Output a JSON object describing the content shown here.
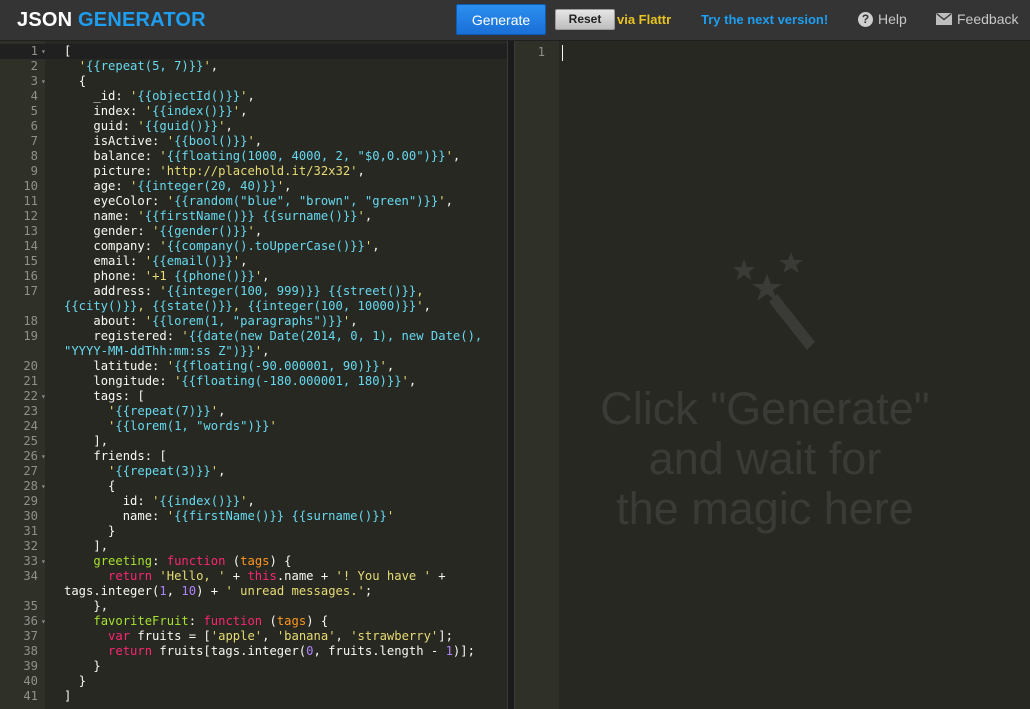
{
  "header": {
    "logo_part1": "JSON ",
    "logo_part2": "GENERATOR",
    "generate_label": "Generate",
    "reset_label": "Reset",
    "flattr_label": "via Flattr",
    "next_version_label": "Try the next version!",
    "help_label": "Help",
    "help_icon": "?",
    "feedback_label": "Feedback"
  },
  "output": {
    "line_number": "1",
    "placeholder_lines": [
      "Click \"Generate\"",
      "and wait for",
      "the magic here"
    ]
  },
  "editor": {
    "line_numbers": [
      "1",
      "2",
      "3",
      "4",
      "5",
      "6",
      "7",
      "8",
      "9",
      "10",
      "11",
      "12",
      "13",
      "14",
      "15",
      "16",
      "17",
      "18",
      "19",
      "20",
      "21",
      "22",
      "23",
      "24",
      "25",
      "26",
      "27",
      "28",
      "29",
      "30",
      "31",
      "32",
      "33",
      "34",
      "35",
      "36",
      "37",
      "38",
      "39",
      "40",
      "41"
    ],
    "lines": [
      [
        {
          "t": "["
        }
      ],
      [
        {
          "t": "  "
        },
        {
          "c": "s",
          "t": "'"
        },
        {
          "c": "t",
          "t": "{{repeat(5, 7)}}"
        },
        {
          "c": "s",
          "t": "'"
        },
        {
          "t": ","
        }
      ],
      [
        {
          "t": "  {"
        }
      ],
      [
        {
          "t": "    _id: "
        },
        {
          "c": "s",
          "t": "'"
        },
        {
          "c": "t",
          "t": "{{objectId()}}"
        },
        {
          "c": "s",
          "t": "'"
        },
        {
          "t": ","
        }
      ],
      [
        {
          "t": "    index: "
        },
        {
          "c": "s",
          "t": "'"
        },
        {
          "c": "t",
          "t": "{{index()}}"
        },
        {
          "c": "s",
          "t": "'"
        },
        {
          "t": ","
        }
      ],
      [
        {
          "t": "    guid: "
        },
        {
          "c": "s",
          "t": "'"
        },
        {
          "c": "t",
          "t": "{{guid()}}"
        },
        {
          "c": "s",
          "t": "'"
        },
        {
          "t": ","
        }
      ],
      [
        {
          "t": "    isActive: "
        },
        {
          "c": "s",
          "t": "'"
        },
        {
          "c": "t",
          "t": "{{bool()}}"
        },
        {
          "c": "s",
          "t": "'"
        },
        {
          "t": ","
        }
      ],
      [
        {
          "t": "    balance: "
        },
        {
          "c": "s",
          "t": "'"
        },
        {
          "c": "t",
          "t": "{{floating(1000, 4000, 2, \"$0,0.00\")}}"
        },
        {
          "c": "s",
          "t": "'"
        },
        {
          "t": ","
        }
      ],
      [
        {
          "t": "    picture: "
        },
        {
          "c": "s",
          "t": "'http://placehold.it/32x32'"
        },
        {
          "t": ","
        }
      ],
      [
        {
          "t": "    age: "
        },
        {
          "c": "s",
          "t": "'"
        },
        {
          "c": "t",
          "t": "{{integer(20, 40)}}"
        },
        {
          "c": "s",
          "t": "'"
        },
        {
          "t": ","
        }
      ],
      [
        {
          "t": "    eyeColor: "
        },
        {
          "c": "s",
          "t": "'"
        },
        {
          "c": "t",
          "t": "{{random(\"blue\", \"brown\", \"green\")}}"
        },
        {
          "c": "s",
          "t": "'"
        },
        {
          "t": ","
        }
      ],
      [
        {
          "t": "    name: "
        },
        {
          "c": "s",
          "t": "'"
        },
        {
          "c": "t",
          "t": "{{firstName()}} {{surname()}}"
        },
        {
          "c": "s",
          "t": "'"
        },
        {
          "t": ","
        }
      ],
      [
        {
          "t": "    gender: "
        },
        {
          "c": "s",
          "t": "'"
        },
        {
          "c": "t",
          "t": "{{gender()}}"
        },
        {
          "c": "s",
          "t": "'"
        },
        {
          "t": ","
        }
      ],
      [
        {
          "t": "    company: "
        },
        {
          "c": "s",
          "t": "'"
        },
        {
          "c": "t",
          "t": "{{company().toUpperCase()}}"
        },
        {
          "c": "s",
          "t": "'"
        },
        {
          "t": ","
        }
      ],
      [
        {
          "t": "    email: "
        },
        {
          "c": "s",
          "t": "'"
        },
        {
          "c": "t",
          "t": "{{email()}}"
        },
        {
          "c": "s",
          "t": "'"
        },
        {
          "t": ","
        }
      ],
      [
        {
          "t": "    phone: "
        },
        {
          "c": "s",
          "t": "'+1 "
        },
        {
          "c": "t",
          "t": "{{phone()}}"
        },
        {
          "c": "s",
          "t": "'"
        },
        {
          "t": ","
        }
      ],
      [
        {
          "t": "    address: "
        },
        {
          "c": "s",
          "t": "'"
        },
        {
          "c": "t",
          "t": "{{integer(100, 999)}} {{street()}}"
        },
        {
          "c": "s",
          "t": ", "
        },
        {
          "c": "t",
          "t": "{{city()}}"
        },
        {
          "c": "s",
          "t": ", "
        },
        {
          "c": "t",
          "t": "{{state()}}"
        },
        {
          "c": "s",
          "t": ", "
        },
        {
          "c": "t",
          "t": "{{integer(100, 10000)}}"
        },
        {
          "c": "s",
          "t": "'"
        },
        {
          "t": ","
        }
      ],
      [
        {
          "t": "    about: "
        },
        {
          "c": "s",
          "t": "'"
        },
        {
          "c": "t",
          "t": "{{lorem(1, \"paragraphs\")}}"
        },
        {
          "c": "s",
          "t": "'"
        },
        {
          "t": ","
        }
      ],
      [
        {
          "t": "    registered: "
        },
        {
          "c": "s",
          "t": "'"
        },
        {
          "c": "t",
          "t": "{{date(new Date(2014, 0, 1), new Date(), \"YYYY-MM-ddThh:mm:ss Z\")}}"
        },
        {
          "c": "s",
          "t": "'"
        },
        {
          "t": ","
        }
      ],
      [
        {
          "t": "    latitude: "
        },
        {
          "c": "s",
          "t": "'"
        },
        {
          "c": "t",
          "t": "{{floating(-90.000001, 90)}}"
        },
        {
          "c": "s",
          "t": "'"
        },
        {
          "t": ","
        }
      ],
      [
        {
          "t": "    longitude: "
        },
        {
          "c": "s",
          "t": "'"
        },
        {
          "c": "t",
          "t": "{{floating(-180.000001, 180)}}"
        },
        {
          "c": "s",
          "t": "'"
        },
        {
          "t": ","
        }
      ],
      [
        {
          "t": "    tags: ["
        }
      ],
      [
        {
          "t": "      "
        },
        {
          "c": "s",
          "t": "'"
        },
        {
          "c": "t",
          "t": "{{repeat(7)}}"
        },
        {
          "c": "s",
          "t": "'"
        },
        {
          "t": ","
        }
      ],
      [
        {
          "t": "      "
        },
        {
          "c": "s",
          "t": "'"
        },
        {
          "c": "t",
          "t": "{{lorem(1, \"words\")}}"
        },
        {
          "c": "s",
          "t": "'"
        }
      ],
      [
        {
          "t": "    ],"
        }
      ],
      [
        {
          "t": "    friends: ["
        }
      ],
      [
        {
          "t": "      "
        },
        {
          "c": "s",
          "t": "'"
        },
        {
          "c": "t",
          "t": "{{repeat(3)}}"
        },
        {
          "c": "s",
          "t": "'"
        },
        {
          "t": ","
        }
      ],
      [
        {
          "t": "      {"
        }
      ],
      [
        {
          "t": "        id: "
        },
        {
          "c": "s",
          "t": "'"
        },
        {
          "c": "t",
          "t": "{{index()}}"
        },
        {
          "c": "s",
          "t": "'"
        },
        {
          "t": ","
        }
      ],
      [
        {
          "t": "        name: "
        },
        {
          "c": "s",
          "t": "'"
        },
        {
          "c": "t",
          "t": "{{firstName()}} {{surname()}}"
        },
        {
          "c": "s",
          "t": "'"
        }
      ],
      [
        {
          "t": "      }"
        }
      ],
      [
        {
          "t": "    ],"
        }
      ],
      [
        {
          "t": "    "
        },
        {
          "c": "p",
          "t": "greeting"
        },
        {
          "t": ": "
        },
        {
          "c": "k",
          "t": "function"
        },
        {
          "t": " ("
        },
        {
          "c": "o",
          "t": "tags"
        },
        {
          "t": ") {"
        }
      ],
      [
        {
          "t": "      "
        },
        {
          "c": "k",
          "t": "return"
        },
        {
          "t": " "
        },
        {
          "c": "s",
          "t": "'Hello, '"
        },
        {
          "t": " + "
        },
        {
          "c": "k",
          "t": "this"
        },
        {
          "t": ".name + "
        },
        {
          "c": "s",
          "t": "'! You have '"
        },
        {
          "t": " + tags.integer("
        },
        {
          "c": "n",
          "t": "1"
        },
        {
          "t": ", "
        },
        {
          "c": "n",
          "t": "10"
        },
        {
          "t": ") + "
        },
        {
          "c": "s",
          "t": "' unread messages.'"
        },
        {
          "t": ";"
        }
      ],
      [
        {
          "t": "    },"
        }
      ],
      [
        {
          "t": "    "
        },
        {
          "c": "p",
          "t": "favoriteFruit"
        },
        {
          "t": ": "
        },
        {
          "c": "k",
          "t": "function"
        },
        {
          "t": " ("
        },
        {
          "c": "o",
          "t": "tags"
        },
        {
          "t": ") {"
        }
      ],
      [
        {
          "t": "      "
        },
        {
          "c": "k",
          "t": "var"
        },
        {
          "t": " fruits = ["
        },
        {
          "c": "s",
          "t": "'apple'"
        },
        {
          "t": ", "
        },
        {
          "c": "s",
          "t": "'banana'"
        },
        {
          "t": ", "
        },
        {
          "c": "s",
          "t": "'strawberry'"
        },
        {
          "t": "];"
        }
      ],
      [
        {
          "t": "      "
        },
        {
          "c": "k",
          "t": "return"
        },
        {
          "t": " fruits[tags.integer("
        },
        {
          "c": "n",
          "t": "0"
        },
        {
          "t": ", fruits.length - "
        },
        {
          "c": "n",
          "t": "1"
        },
        {
          "t": ")];"
        }
      ],
      [
        {
          "t": "    }"
        }
      ],
      [
        {
          "t": "  }"
        }
      ],
      [
        {
          "t": "]"
        }
      ]
    ],
    "fold_lines": [
      1,
      3,
      22,
      26,
      28,
      33,
      36
    ]
  }
}
